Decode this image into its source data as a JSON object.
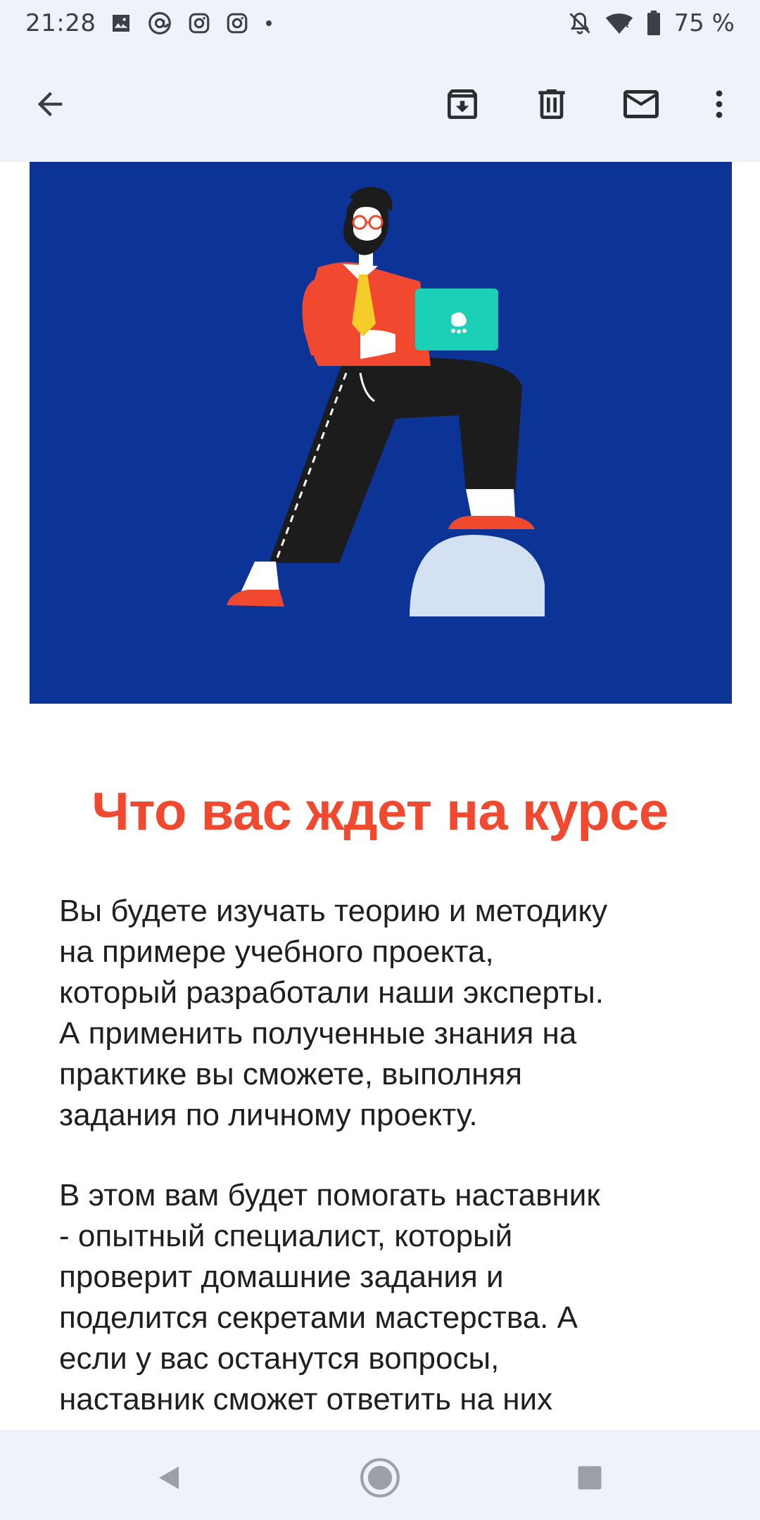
{
  "status_bar": {
    "time": "21:28",
    "notification_icons": [
      "image-icon",
      "at-icon",
      "instagram-icon",
      "instagram-icon",
      "dot-icon"
    ],
    "right_icons": [
      "bell-off-icon",
      "wifi-icon",
      "battery-icon"
    ],
    "battery_text": "75 %"
  },
  "toolbar": {
    "back_icon": "arrow-left-icon",
    "actions": [
      "archive-icon",
      "delete-icon",
      "mail-icon",
      "more-vert-icon"
    ]
  },
  "email": {
    "hero_image": {
      "background_color": "#0c3396",
      "subject": "man-with-laptop-illustration"
    },
    "headline": "Что вас ждет на курсе",
    "headline_color": "#f0492f",
    "paragraph1_lines": [
      "Вы будете изучать теорию и методику",
      "на примере учебного проекта,",
      "который разработали наши эксперты.",
      "А применить полученные знания на",
      "практике вы сможете, выполняя",
      "задания по личному проекту."
    ],
    "paragraph2_lines": [
      "В этом вам будет помогать наставник",
      "- опытный специалист, который",
      "проверит домашние задания и",
      "поделится секретами мастерства. А",
      "если у вас останутся вопросы,",
      "наставник сможет ответить на них"
    ]
  },
  "nav_bar": {
    "buttons": [
      "back-triangle-icon",
      "home-circle-icon",
      "recents-square-icon"
    ]
  }
}
